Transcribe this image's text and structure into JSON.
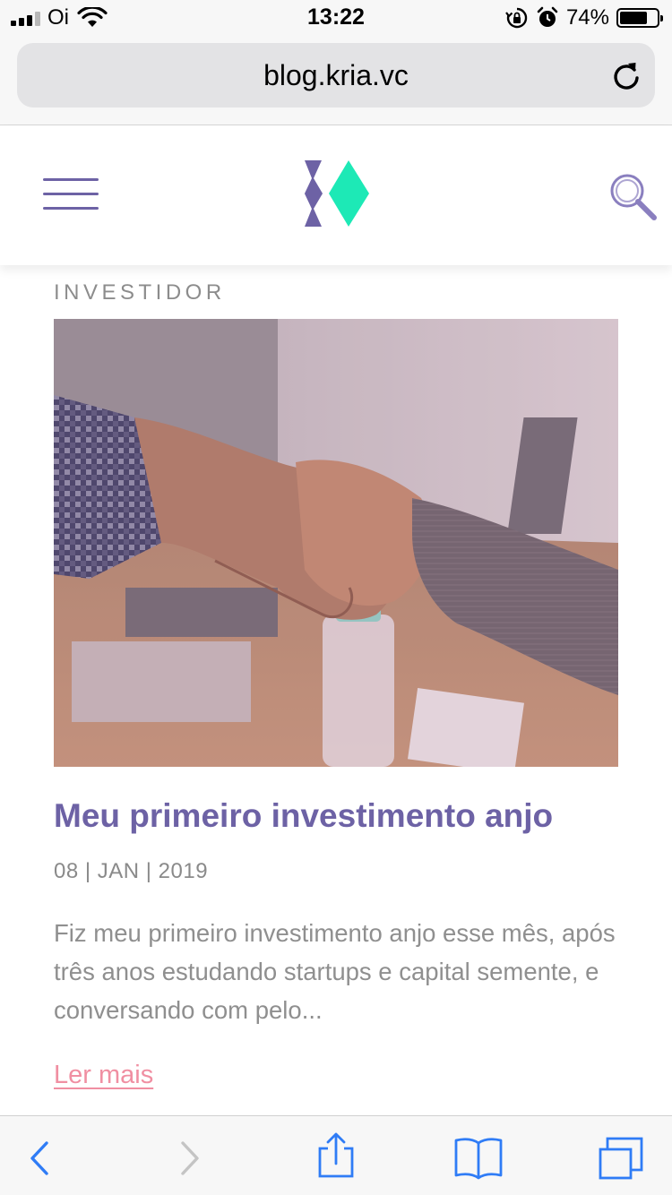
{
  "status_bar": {
    "carrier": "Oi",
    "time": "13:22",
    "battery_percent": "74%",
    "battery_level": 0.74,
    "signal_bars_filled": 3,
    "signal_bars_total": 4
  },
  "browser": {
    "url": "blog.kria.vc"
  },
  "site": {
    "brand_colors": {
      "purple": "#6d62a5",
      "green": "#1de9b6"
    },
    "icons": [
      "hamburger-menu-icon",
      "kria-logo",
      "search-icon"
    ]
  },
  "post": {
    "category": "INVESTIDOR",
    "image_description_icon": "handshake-photo",
    "title": "Meu primeiro investimento anjo",
    "date": "08 | JAN | 2019",
    "excerpt": "Fiz meu primeiro investimento anjo esse mês, após três anos estudando startups e capital semente, e conversando com pelo...",
    "read_more": "Ler mais"
  },
  "toolbar": {
    "icons": [
      "back-arrow-icon",
      "forward-arrow-icon",
      "share-icon",
      "bookmarks-icon",
      "tabs-icon"
    ],
    "accent": "#2f7cf6"
  }
}
